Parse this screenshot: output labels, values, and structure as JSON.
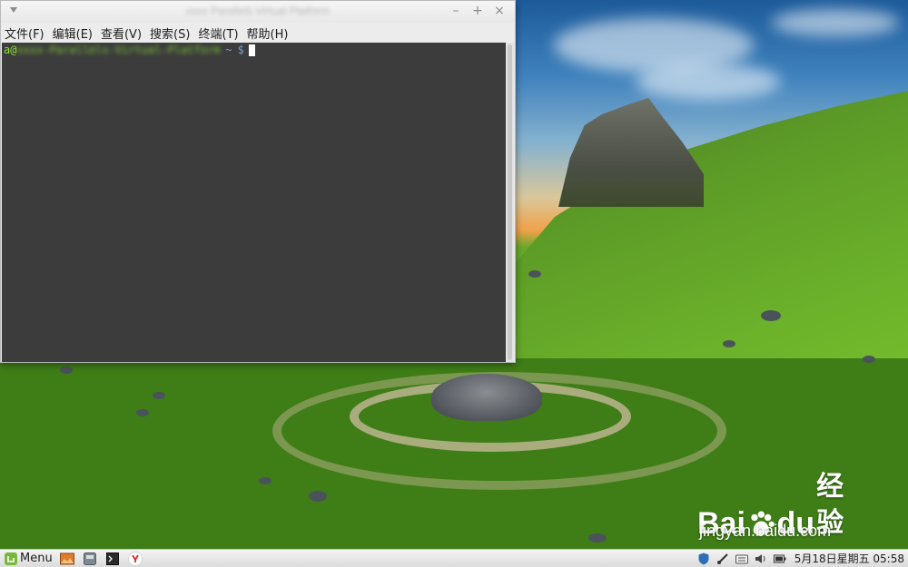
{
  "terminal": {
    "title": "xxxx Parallels Virtual Platform",
    "menu": [
      "文件(F)",
      "编辑(E)",
      "查看(V)",
      "搜索(S)",
      "终端(T)",
      "帮助(H)"
    ],
    "prompt": {
      "user": "a@",
      "host": "xxxx-Parallels-Virtual-Platform",
      "path": "~",
      "symbol": "$"
    },
    "window_controls": [
      "–",
      "+",
      "×"
    ]
  },
  "watermark": {
    "logo_bai": "Bai",
    "logo_du": "du",
    "logo_jingyan": "经验",
    "url": "jingyan.baidu.com"
  },
  "panel": {
    "menu_label": "Menu",
    "launchers": [
      "image-viewer-icon",
      "disk-icon",
      "terminal-icon",
      "yandex-browser-icon"
    ],
    "tray": [
      "shield-icon",
      "network-icon",
      "keyboard-icon",
      "volume-icon",
      "battery-icon"
    ],
    "clock": "5月18日星期五 05:58"
  },
  "colors": {
    "terminal_bg": "#3c3c3c",
    "prompt_green": "#8ae234",
    "prompt_blue": "#729fcf",
    "mint_green": "#79b83b"
  }
}
